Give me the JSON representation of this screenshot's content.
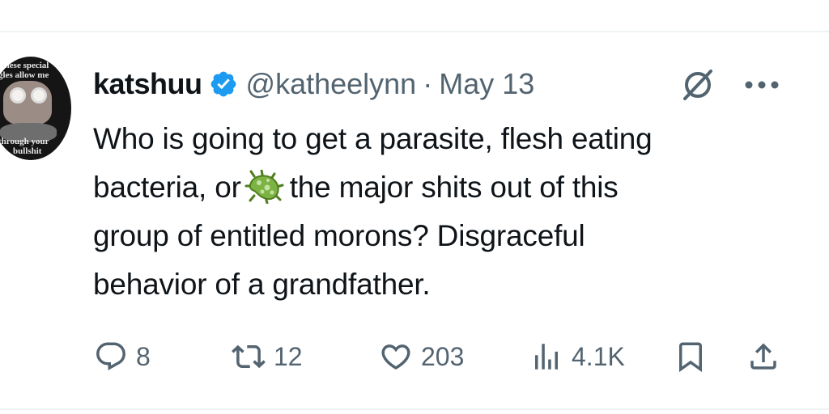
{
  "tweet": {
    "author": {
      "display_name": "katshuu",
      "handle": "@katheelynn",
      "verified": true,
      "avatar_text": {
        "top_line1": "these special",
        "top_line2": "gles allow me",
        "bottom_line1": "through your",
        "bottom_line2": "bullshit"
      }
    },
    "separator": "·",
    "date": "May 13",
    "text_lines": [
      "Who is going to get a parasite, flesh eating",
      "bacteria, or",
      "the major shits out of this",
      "group of entitled morons? Disgraceful",
      "behavior of a grandfather."
    ],
    "inline_emoji": "microbe-icon",
    "stats": {
      "replies": "8",
      "reposts": "12",
      "likes": "203",
      "views": "4.1K"
    }
  },
  "icons": [
    "verified-badge-icon",
    "grok-icon",
    "more-icon",
    "reply-icon",
    "repost-icon",
    "like-icon",
    "views-icon",
    "bookmark-icon",
    "share-icon",
    "microbe-icon"
  ],
  "colors": {
    "text": "#0f1419",
    "secondary": "#536471",
    "verified": "#1d9bf0",
    "divider": "#eff3f4",
    "microbe": "#7cb342"
  }
}
